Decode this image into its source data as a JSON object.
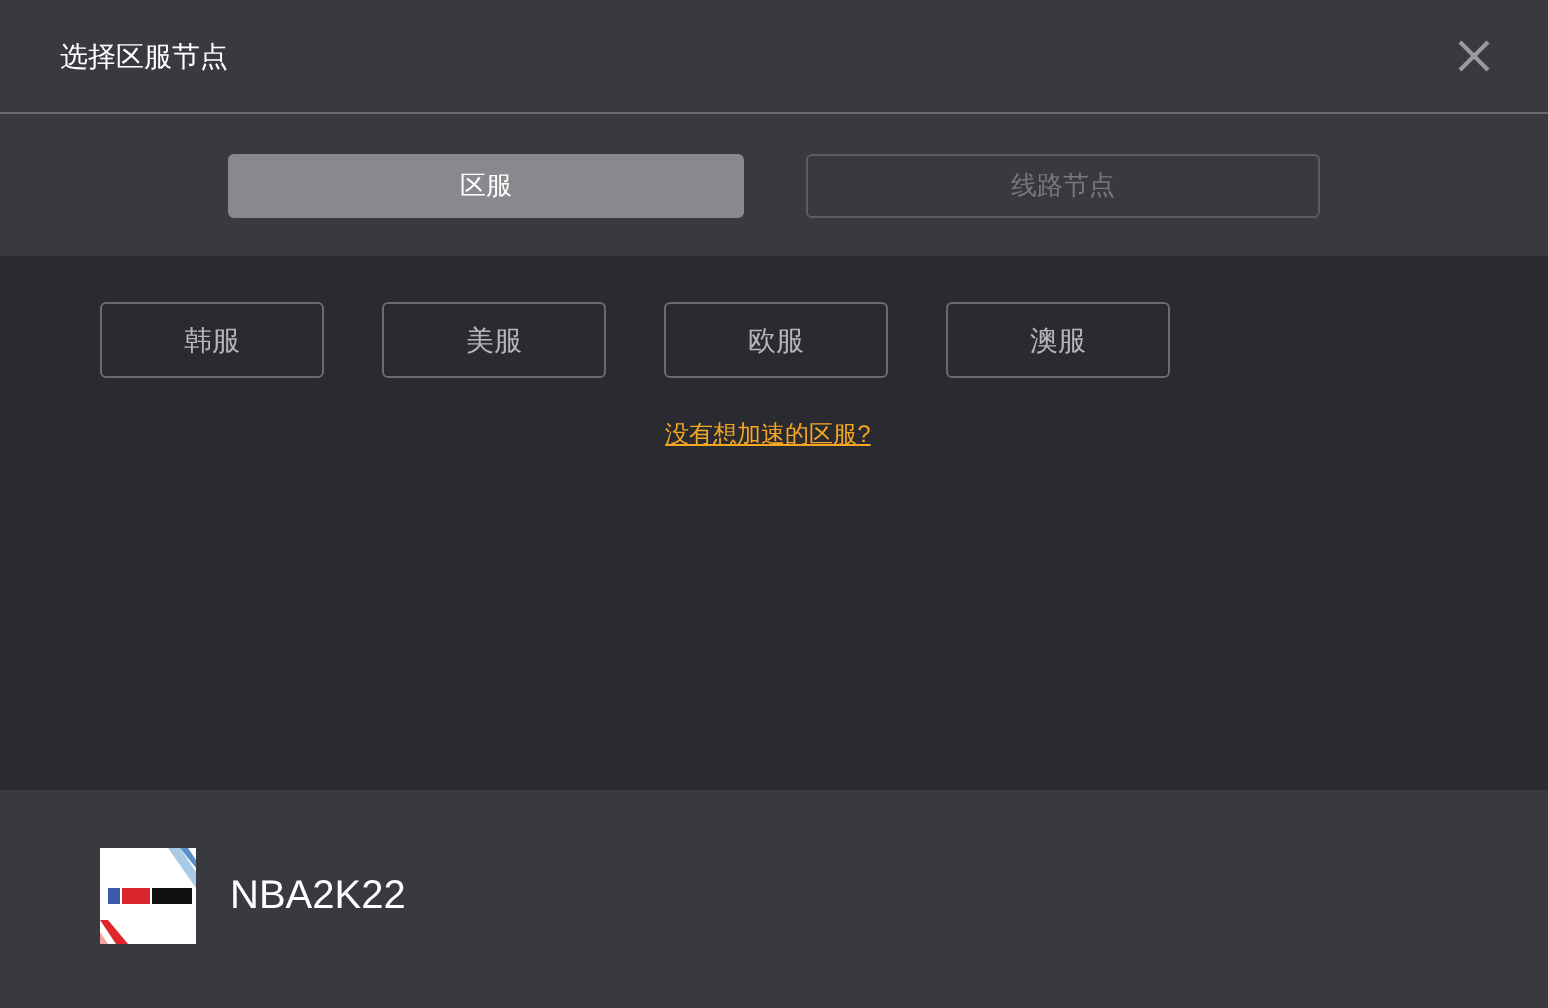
{
  "window": {
    "title": "选择区服节点"
  },
  "tabs": [
    {
      "label": "区服",
      "selected": true
    },
    {
      "label": "线路节点",
      "selected": false
    }
  ],
  "regions": [
    "韩服",
    "美服",
    "欧服",
    "澳服"
  ],
  "help_link": "没有想加速的区服?",
  "game": {
    "name": "NBA2K22"
  }
}
